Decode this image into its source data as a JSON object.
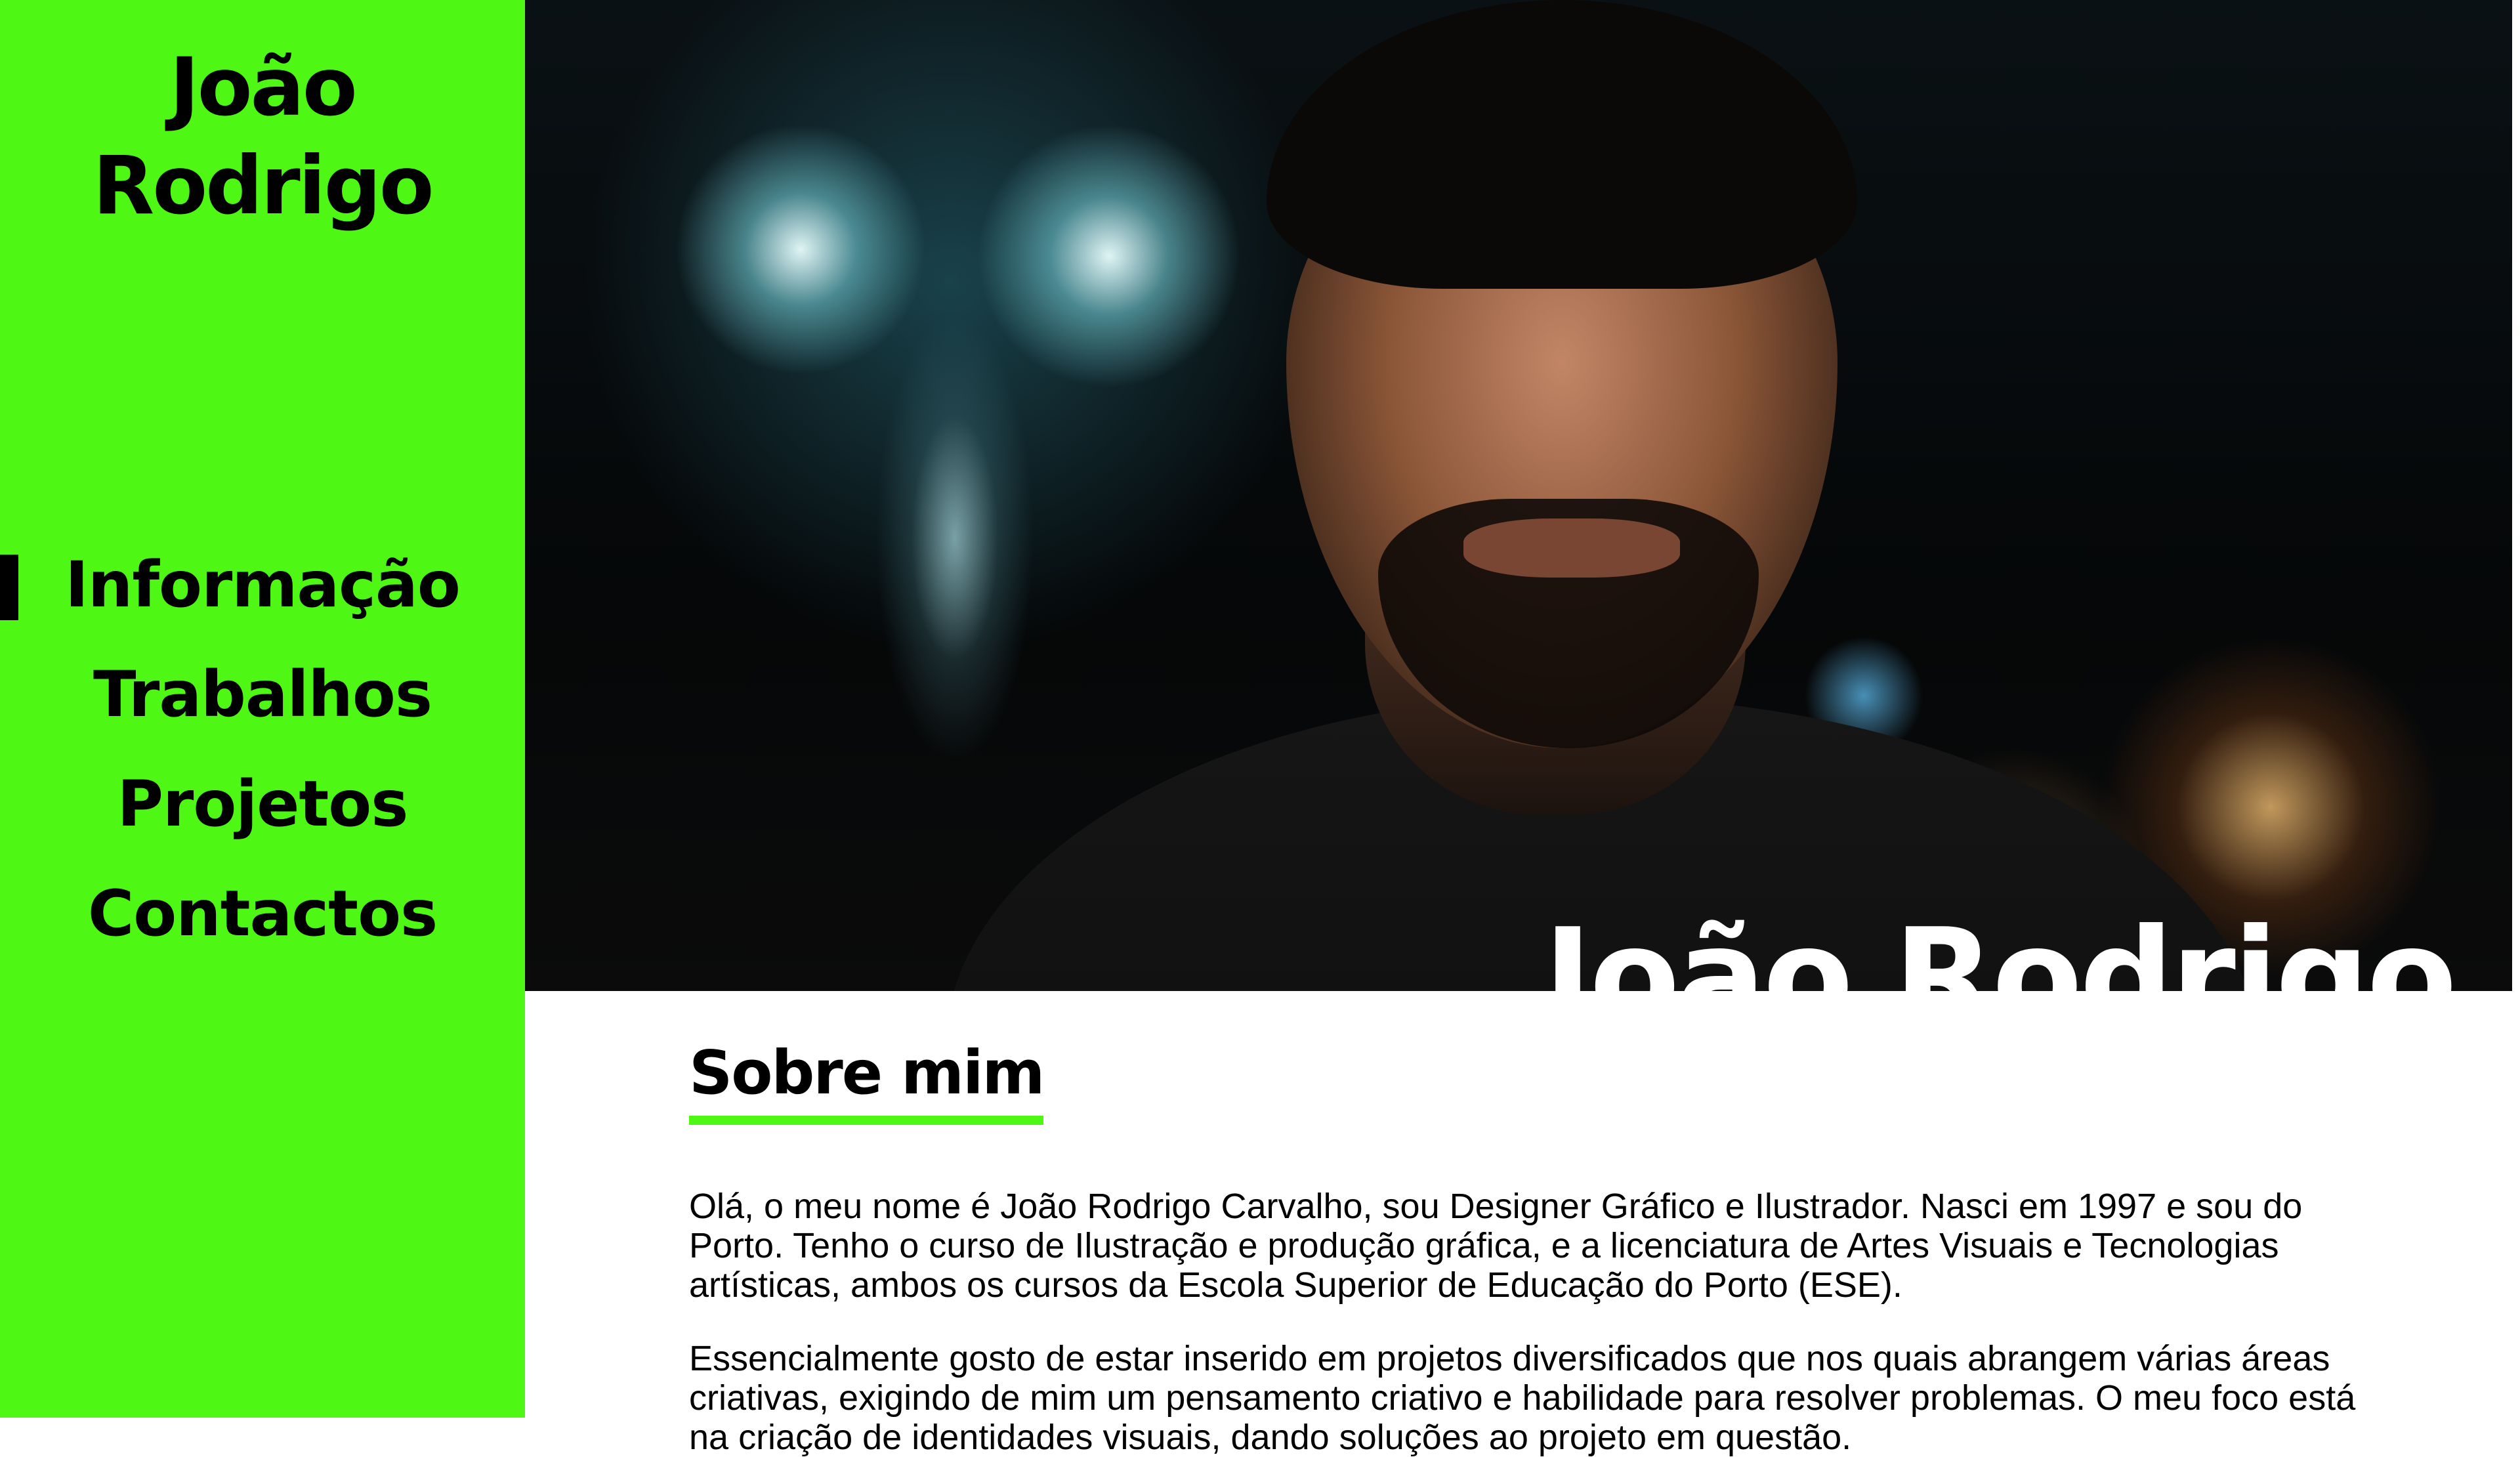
{
  "sidebar": {
    "brand": "João Rodrigo",
    "nav": [
      {
        "label": "Informação",
        "active": true
      },
      {
        "label": "Trabalhos",
        "active": false
      },
      {
        "label": "Projetos",
        "active": false
      },
      {
        "label": "Contactos",
        "active": false
      }
    ]
  },
  "hero": {
    "title": "João Rodrigo"
  },
  "about": {
    "title": "Sobre mim",
    "paragraphs": [
      "Olá, o meu nome é João Rodrigo Carvalho, sou Designer Gráfico e Ilustrador. Nasci em 1997 e sou do Porto. Tenho o curso de Ilustração e produção gráfica, e a licenciatura de Artes Visuais e Tecnologias artísticas, ambos os cursos da Escola Superior de Educação do Porto (ESE).",
      "Essencialmente gosto de estar inserido em projetos diversificados que nos quais abrangem várias áreas criativas, exigindo de mim um pensamento criativo e habilidade para resolver problemas. O meu foco está na criação de identidades visuais, dando soluções ao projeto em questão."
    ]
  },
  "colors": {
    "accent": "#4ef814",
    "text": "#000000",
    "background": "#ffffff"
  }
}
